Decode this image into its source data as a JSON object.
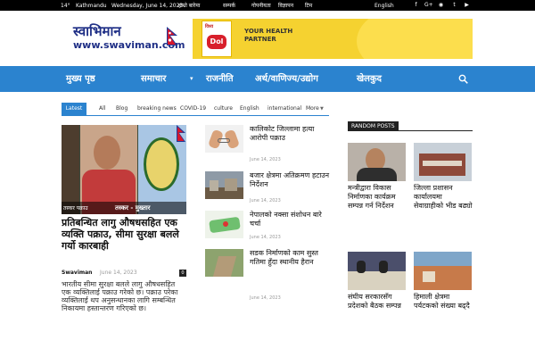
{
  "topbar": {
    "temperature": "14",
    "city": "Kathmandu",
    "date": "Wednesday, June 14, 2023",
    "links": [
      "हाम्रो बारेमा",
      "सम्पर्क",
      "गोपनीयता",
      "विज्ञापन",
      "टिम"
    ],
    "english": "English",
    "social_icons": [
      "facebook-icon",
      "google-plus-icon",
      "instagram-icon",
      "twitter-icon",
      "youtube-icon"
    ]
  },
  "header": {
    "logo_nepali": "स्वाभिमान",
    "logo_web": "www.swaviman.com",
    "ad": {
      "badge_top": "विश्व",
      "badge_main": "Dol",
      "tagline": "YOUR HEALTH PARTNER"
    }
  },
  "nav": {
    "items": [
      "मुख्य पृष्ठ",
      "समाचार",
      "राजनीति",
      "अर्थ/वाणिज्य/उद्योग",
      "खेलकुद"
    ],
    "search_icon": "search-icon"
  },
  "tabs": {
    "items": [
      "Latest",
      "All",
      "Blog",
      "breaking news",
      "COVID-19",
      "culture",
      "English",
      "international",
      "More"
    ],
    "active": "Latest"
  },
  "feature": {
    "caption_left": "तस्कर पक्राउ",
    "caption_right": "तस्कर - मुख्तार",
    "title": "प्रतिबन्धित लागु औषधसहित एक व्यक्ति पक्राउ, सीमा सुरक्षा बलले गर्यो कारबाही",
    "author": "Swaviman",
    "date": "June 14, 2023",
    "comments": "0",
    "excerpt": "भारतीय सीमा सुरक्षा बलले लागु औषधसहित एक व्यक्तिलाई पक्राउ गरेको छ। पक्राउ परेका व्यक्तिलाई थप अनुसन्धानका लागि सम्बन्धित निकायमा हस्तान्तरण गरिएको छ।"
  },
  "middle_list": [
    {
      "title": "कालिकोट जिल्लामा हत्या आरोपी पक्राउ",
      "date": "June 14, 2023"
    },
    {
      "title": "बजार क्षेत्रमा अतिक्रमण हटाउन निर्देशन",
      "date": "June 14, 2023"
    },
    {
      "title": "नेपालको नक्सा संशोधन बारे चर्चा",
      "date": "June 14, 2023"
    },
    {
      "title": "सडक निर्माणको काम सुस्त गतिमा हुँदा स्थानीय हैरान",
      "date": "June 14, 2023"
    }
  ],
  "random_posts": {
    "label": "RANDOM POSTS",
    "items": [
      {
        "title": "मन्त्रीद्वारा विकास निर्माणका कार्यक्रम सम्पन्न गर्न निर्देशन"
      },
      {
        "title": "जिल्ला प्रशासन कार्यालयमा सेवाग्राहीको भीड बढ्यो"
      },
      {
        "title": "संघीय सरकारसँग प्रदेशको बैठक सम्पन्न"
      },
      {
        "title": "हिमाली क्षेत्रमा पर्यटकको संख्या बढ्दै"
      }
    ]
  }
}
